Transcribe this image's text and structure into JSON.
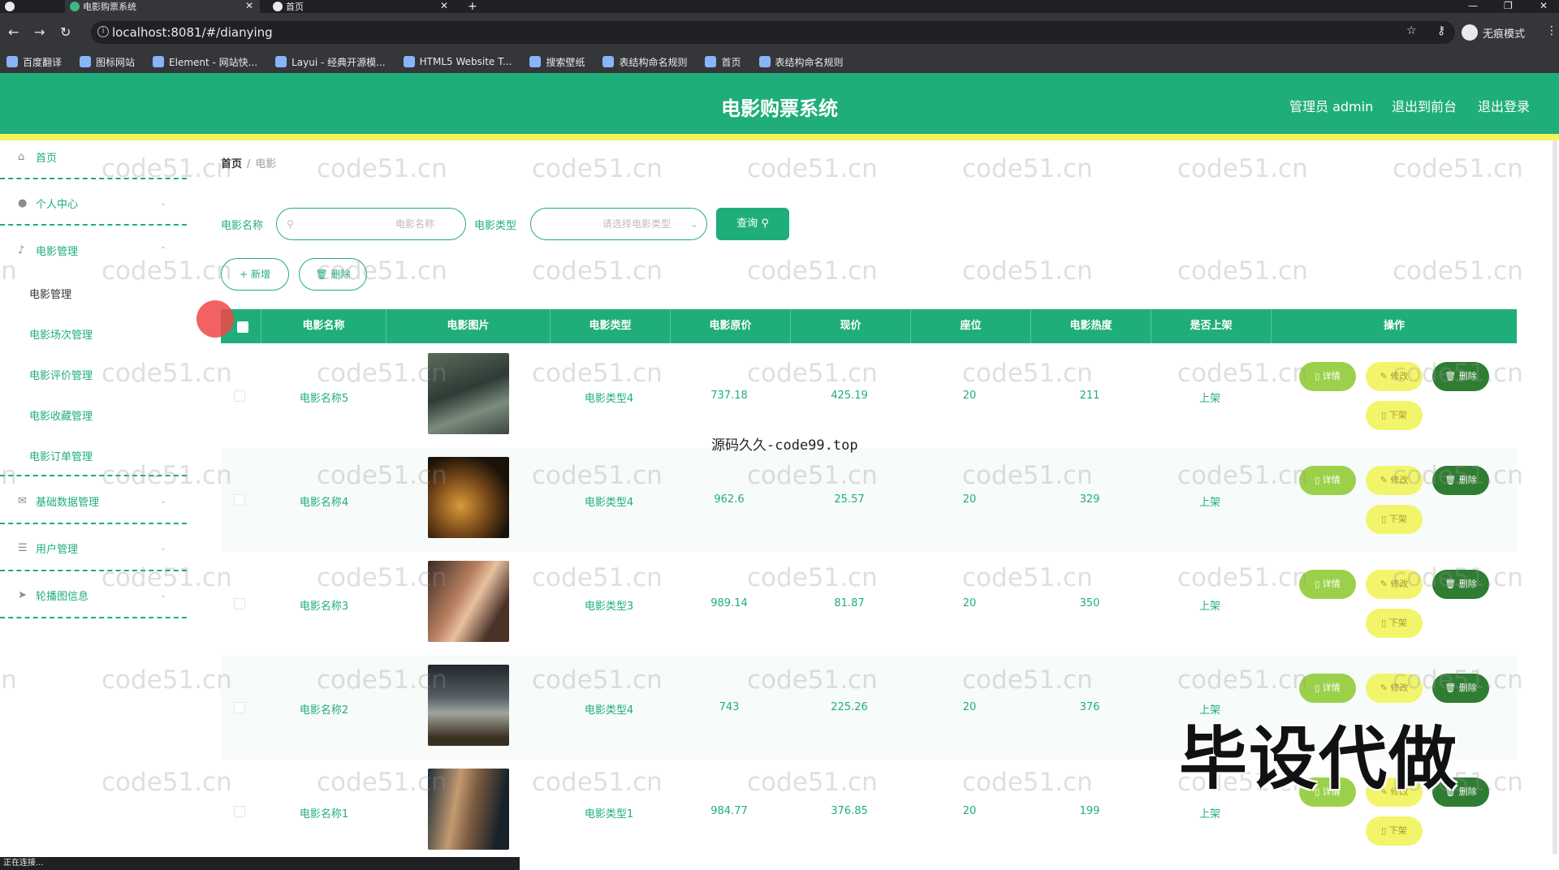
{
  "browser": {
    "tabs": [
      {
        "label": "电影购票系统",
        "active": true
      },
      {
        "label": "首页",
        "active": false
      }
    ],
    "url": "localhost:8081/#/dianying",
    "incognito_label": "无痕模式",
    "bookmarks": [
      "百度翻译",
      "图标网站",
      "Element - 网站快...",
      "Layui - 经典开源模...",
      "HTML5 Website T...",
      "搜索壁纸",
      "表结构命名规则",
      "首页",
      "表结构命名规则"
    ],
    "status_text": "正在连接..."
  },
  "header": {
    "title": "电影购票系统",
    "admin": "管理员 admin",
    "back_to_front": "退出到前台",
    "logout": "退出登录",
    "accent": "#1fae7a",
    "stripe": "#f4f458"
  },
  "sidebar": {
    "home": "首页",
    "personal": "个人中心",
    "movie_mgmt": "电影管理",
    "movie_subitems": [
      "电影管理",
      "电影场次管理",
      "电影评价管理",
      "电影收藏管理",
      "电影订单管理"
    ],
    "basic_data": "基础数据管理",
    "user_mgmt": "用户管理",
    "carousel": "轮播图信息"
  },
  "breadcrumb": {
    "home": "首页",
    "sep": "/",
    "current": "电影"
  },
  "filters": {
    "name_label": "电影名称",
    "name_placeholder": "电影名称",
    "type_label": "电影类型",
    "type_placeholder": "请选择电影类型",
    "query": "查询"
  },
  "actions": {
    "add": "新增",
    "delete": "删除"
  },
  "table": {
    "columns": [
      "电影名称",
      "电影图片",
      "电影类型",
      "电影原价",
      "现价",
      "座位",
      "电影热度",
      "是否上架",
      "操作"
    ],
    "btn_detail": "详情",
    "btn_edit": "修改",
    "btn_delete": "删除",
    "btn_down": "下架",
    "rows": [
      {
        "name": "电影名称5",
        "type": "电影类型4",
        "price": "737.18",
        "now": "425.19",
        "seats": "20",
        "heat": "211",
        "status": "上架"
      },
      {
        "name": "电影名称4",
        "type": "电影类型4",
        "price": "962.6",
        "now": "25.57",
        "seats": "20",
        "heat": "329",
        "status": "上架"
      },
      {
        "name": "电影名称3",
        "type": "电影类型3",
        "price": "989.14",
        "now": "81.87",
        "seats": "20",
        "heat": "350",
        "status": "上架"
      },
      {
        "name": "电影名称2",
        "type": "电影类型4",
        "price": "743",
        "now": "225.26",
        "seats": "20",
        "heat": "376",
        "status": "上架"
      },
      {
        "name": "电影名称1",
        "type": "电影类型1",
        "price": "984.77",
        "now": "376.85",
        "seats": "20",
        "heat": "199",
        "status": "上架"
      }
    ]
  },
  "watermarks": {
    "site": "code51.cn",
    "source": "源码久久-code99.top",
    "big": "毕设代做"
  }
}
